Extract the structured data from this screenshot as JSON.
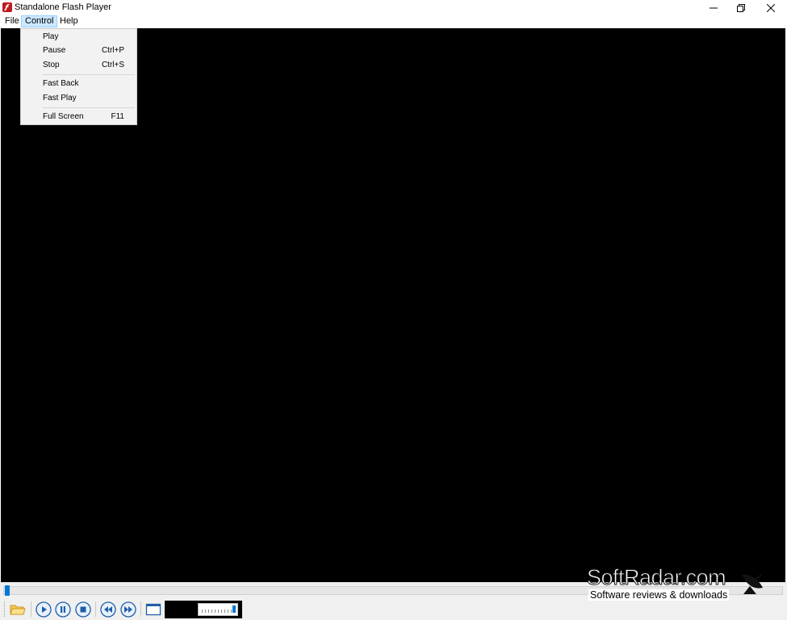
{
  "window": {
    "title": "Standalone Flash Player",
    "controls": {
      "minimize_icon": "minimize-icon",
      "maximize_icon": "restore-icon",
      "close_icon": "close-icon"
    }
  },
  "menubar": {
    "items": [
      {
        "label": "File"
      },
      {
        "label": "Control",
        "open": true
      },
      {
        "label": "Help"
      }
    ]
  },
  "control_menu": {
    "items": [
      {
        "label": "Play",
        "shortcut": ""
      },
      {
        "label": "Pause",
        "shortcut": "Ctrl+P"
      },
      {
        "label": "Stop",
        "shortcut": "Ctrl+S"
      },
      {
        "label": "Fast Back",
        "shortcut": ""
      },
      {
        "label": "Fast Play",
        "shortcut": ""
      },
      {
        "label": "Full Screen",
        "shortcut": "F11"
      }
    ]
  },
  "seekbar": {
    "position": 0.0
  },
  "toolbar": {
    "buttons": [
      "open-folder-icon",
      "play-icon",
      "pause-icon",
      "stop-icon",
      "rewind-icon",
      "fast-forward-icon",
      "fullscreen-icon"
    ],
    "volume_level": 0.95
  },
  "watermark": {
    "brand": "SoftRadar.com",
    "tagline": "Software reviews & downloads"
  },
  "colors": {
    "stage": "#000000",
    "accent": "#0078d7",
    "menu_highlight": "#cce8ff",
    "flash_red": "#c0191e"
  }
}
